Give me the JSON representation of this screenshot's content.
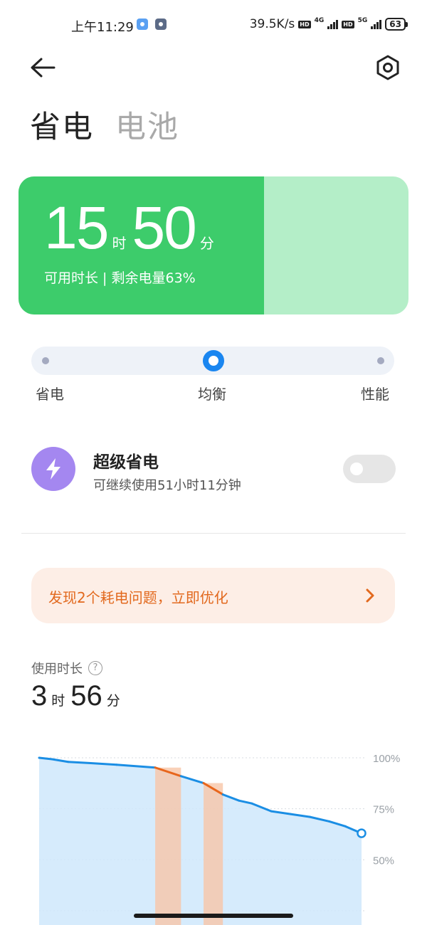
{
  "status_bar": {
    "time": "上午11:29",
    "net_speed": "39.5K/s",
    "hd_1": "HD",
    "net_1": "4G",
    "hd_2": "HD",
    "net_2": "5G",
    "battery": "63"
  },
  "header": {
    "back_icon": "arrow-left-icon",
    "settings_icon": "hexagon-settings-icon",
    "tabs": [
      {
        "label": "省电",
        "active": true
      },
      {
        "label": "电池",
        "active": false
      }
    ]
  },
  "battery_card": {
    "hours": "15",
    "hours_unit": "时",
    "minutes": "50",
    "minutes_unit": "分",
    "subtitle": "可用时长 | 剩余电量63%",
    "level_percent": 63,
    "fill_color": "#3dcc6b",
    "track_color": "#b4eec8"
  },
  "mode_slider": {
    "options": [
      "省电",
      "均衡",
      "性能"
    ],
    "selected_index": 1,
    "accent": "#1a86f0"
  },
  "super_saver": {
    "icon": "lightning-bolt-icon",
    "title": "超级省电",
    "subtitle": "可继续使用51小时11分钟",
    "enabled": false
  },
  "alert": {
    "text": "发现2个耗电问题，立即优化",
    "color": "#e2691e"
  },
  "usage": {
    "label": "使用时长",
    "hours": "3",
    "hours_unit": "时",
    "minutes": "56",
    "minutes_unit": "分"
  },
  "chart_data": {
    "type": "line",
    "ytick_labels": [
      "100%",
      "75%",
      "50%"
    ],
    "ylim": [
      25,
      100
    ],
    "x": [
      0,
      4,
      9,
      16,
      24,
      36,
      44,
      51,
      57,
      62,
      66,
      72,
      78,
      84,
      90,
      95,
      100
    ],
    "y": [
      100,
      99.3,
      98,
      97.4,
      96.6,
      95.2,
      91,
      87.6,
      82,
      79,
      77.6,
      73.8,
      72.4,
      71,
      68.8,
      66.4,
      63
    ],
    "highlight_ranges": [
      [
        36,
        44
      ],
      [
        51,
        57
      ]
    ],
    "line_color": "#1b8ee4",
    "highlight_color": "#e8661c",
    "area_color": "#cfe8fb",
    "grid": true
  }
}
